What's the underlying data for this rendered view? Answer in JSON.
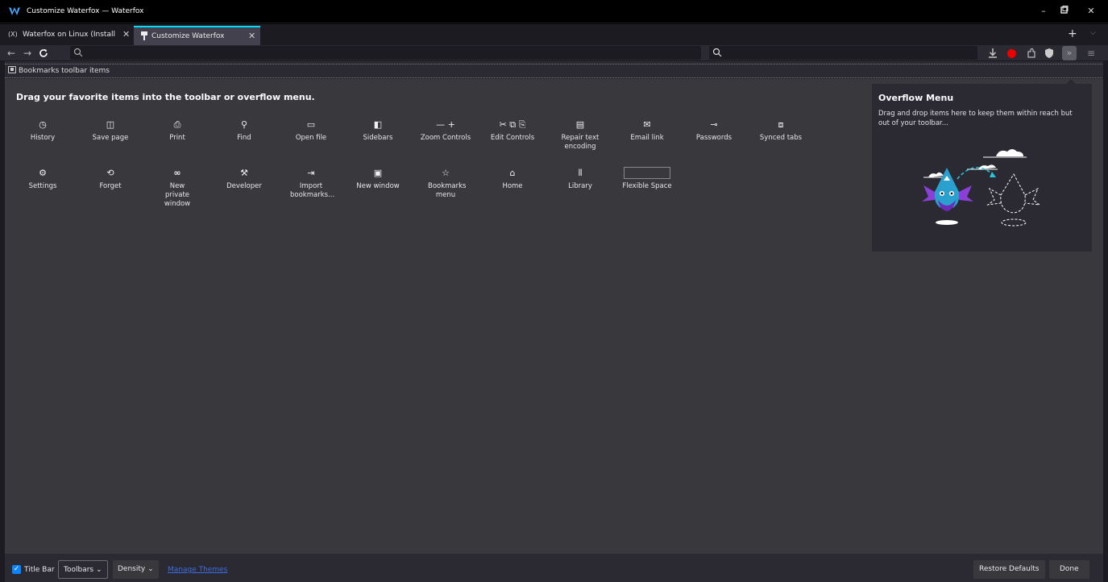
{
  "window": {
    "title": "Customize Waterfox — Waterfox",
    "controls": [
      "–",
      "▫",
      "✕"
    ]
  },
  "tabs": [
    {
      "icon": "(X)",
      "label": "Waterfox on Linux (Install",
      "close": "✕",
      "selected": false
    },
    {
      "icon": "plug-icon",
      "label": "Customize Waterfox",
      "close": "✕",
      "selected": true
    }
  ],
  "tabstrip": {
    "new_tab": "+",
    "list_all": "⌵"
  },
  "navbar": {
    "back": "←",
    "forward": "→",
    "reload": "C",
    "url_value": "",
    "search_value": ""
  },
  "bookmarks_toolbar": {
    "label": "Bookmarks toolbar items"
  },
  "customize": {
    "heading": "Drag your favorite items into the toolbar or overflow menu.",
    "items_row1": [
      {
        "icon": "◷",
        "label": "History"
      },
      {
        "icon": "◫",
        "label": "Save page"
      },
      {
        "icon": "⎙",
        "label": "Print"
      },
      {
        "icon": "⚲",
        "label": "Find"
      },
      {
        "icon": "▭",
        "label": "Open file"
      },
      {
        "icon": "◧",
        "label": "Sidebars"
      },
      {
        "icon": "— +",
        "label": "Zoom Controls"
      },
      {
        "icon": "✂ ⧉ ⎘",
        "label": "Edit Controls"
      },
      {
        "icon": "▤",
        "label": "Repair text encoding"
      },
      {
        "icon": "✉",
        "label": "Email link"
      },
      {
        "icon": "⊸",
        "label": "Passwords"
      },
      {
        "icon": "⧈",
        "label": "Synced tabs"
      }
    ],
    "items_row2": [
      {
        "icon": "⚙",
        "label": "Settings"
      },
      {
        "icon": "⟲",
        "label": "Forget"
      },
      {
        "icon": "∞",
        "label": "New private window"
      },
      {
        "icon": "⚒",
        "label": "Developer"
      },
      {
        "icon": "⇥",
        "label": "Import bookmarks..."
      },
      {
        "icon": "▣",
        "label": "New window"
      },
      {
        "icon": "☆",
        "label": "Bookmarks menu"
      },
      {
        "icon": "⌂",
        "label": "Home"
      },
      {
        "icon": "⫴",
        "label": "Library"
      },
      {
        "icon": "",
        "label": "Flexible Space"
      }
    ]
  },
  "overflow_menu": {
    "title": "Overflow Menu",
    "description": "Drag and drop items here to keep them within reach but out of your toolbar..."
  },
  "footer": {
    "title_bar_label": "Title Bar",
    "title_bar_checked": true,
    "toolbars_label": "Toolbars",
    "density_label": "Density",
    "manage_themes_label": "Manage Themes",
    "restore_label": "Restore Defaults",
    "done_label": "Done"
  },
  "colors": {
    "accent": "#00ddff",
    "checkbox": "#0a84ff",
    "record": "#ee0000",
    "link": "#3b6ee0"
  }
}
